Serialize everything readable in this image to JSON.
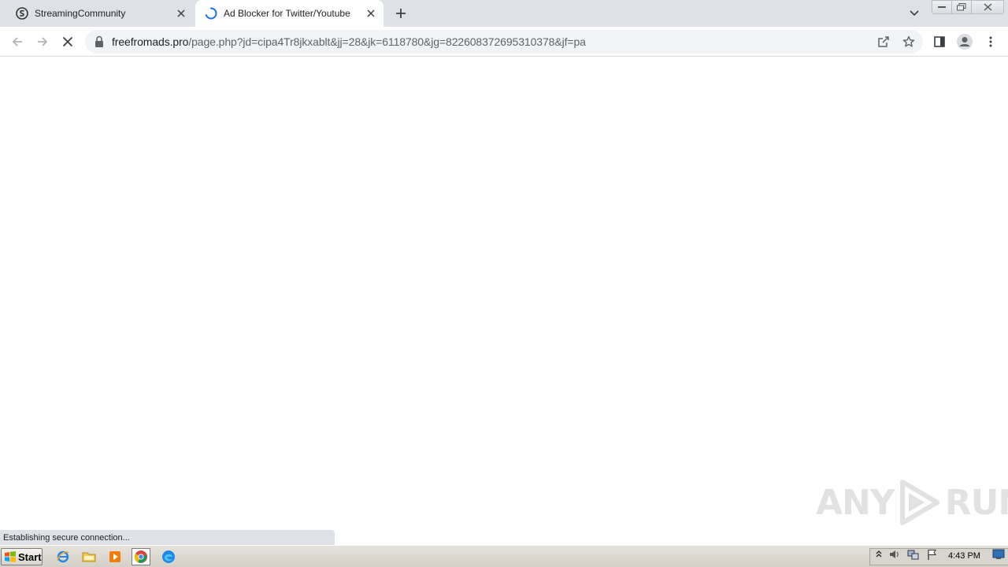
{
  "tabs": [
    {
      "title": "StreamingCommunity",
      "favicon": "streamingcommunity-icon",
      "active": false
    },
    {
      "title": "Ad Blocker for Twitter/Youtube",
      "favicon": "loading-spinner-icon",
      "active": true
    }
  ],
  "address_bar": {
    "domain": "freefromads.pro",
    "path": "/page.php?jd=cipa4Tr8jkxablt&jj=28&jk=6118780&jg=822608372695310378&jf=pa"
  },
  "status_bar": {
    "text": "Establishing secure connection..."
  },
  "watermark": {
    "left": "ANY",
    "right": "RUN"
  },
  "taskbar": {
    "start_label": "Start",
    "clock": "4:43 PM"
  },
  "colors": {
    "tabstrip": "#dee1e6",
    "omnibox": "#f1f3f4",
    "spinner": "#1a73e8",
    "taskbar": "#d4d0c8"
  }
}
